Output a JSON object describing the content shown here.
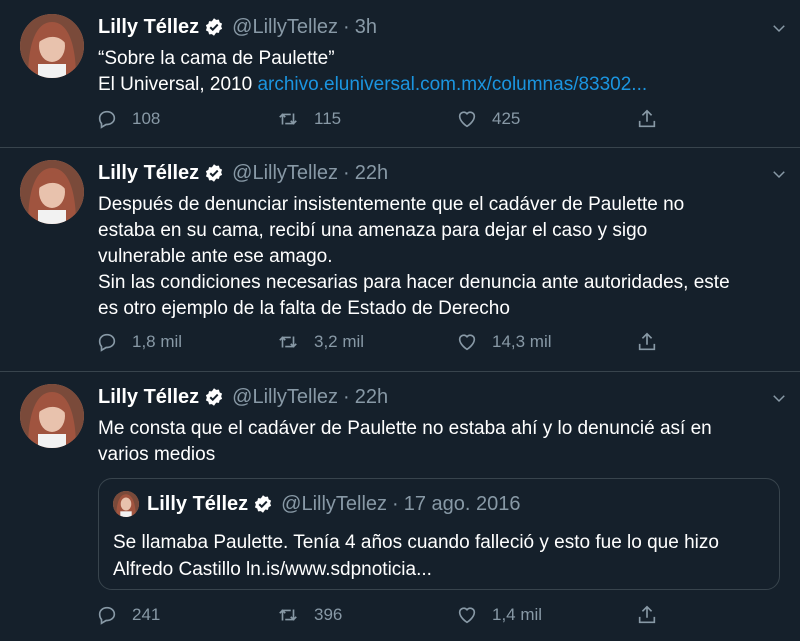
{
  "tweets": [
    {
      "name": "Lilly Téllez",
      "handle": "@LillyTellez",
      "time": "3h",
      "lines": [
        "“Sobre la cama de Paulette”"
      ],
      "line2_prefix": "El Universal, 2010 ",
      "line2_link": "archivo.eluniversal.com.mx/columnas/83302...",
      "replies": "108",
      "retweets": "115",
      "likes": "425"
    },
    {
      "name": "Lilly Téllez",
      "handle": "@LillyTellez",
      "time": "22h",
      "lines": [
        "Después de denunciar insistentemente que el cadáver de Paulette no",
        "estaba en su cama, recibí una amenaza para dejar el caso y sigo",
        "vulnerable ante ese amago.",
        "Sin las condiciones necesarias para hacer denuncia ante autoridades, este",
        "es otro ejemplo de la falta de Estado de Derecho"
      ],
      "replies": "1,8 mil",
      "retweets": "3,2 mil",
      "likes": "14,3 mil"
    },
    {
      "name": "Lilly Téllez",
      "handle": "@LillyTellez",
      "time": "22h",
      "lines": [
        "Me consta que el cadáver de Paulette no estaba ahí y lo denuncié así en",
        "varios medios"
      ],
      "quote": {
        "name": "Lilly Téllez",
        "handle": "@LillyTellez",
        "time": "17 ago. 2016",
        "lines": [
          "Se llamaba Paulette. Tenía 4 años cuando falleció y esto fue lo que hizo",
          "Alfredo Castillo ln.is/www.sdpnoticia..."
        ]
      },
      "replies": "241",
      "retweets": "396",
      "likes": "1,4 mil"
    }
  ],
  "separator": "·",
  "colors": {
    "background": "#15202b",
    "border": "#38444d",
    "secondary_text": "#8899a6",
    "link": "#1b95e0",
    "verified": "#ffffff"
  },
  "icons": {
    "reply": "reply-icon",
    "retweet": "retweet-icon",
    "like": "heart-icon",
    "share": "share-icon",
    "verified": "verified-badge-icon",
    "caret": "chevron-down-icon"
  }
}
